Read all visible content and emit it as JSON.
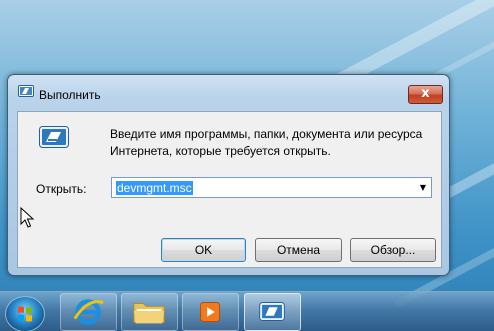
{
  "dialog": {
    "title": "Выполнить",
    "close_glyph": "x",
    "icon": "run-icon",
    "description_line1": "Введите имя программы, папки, документа или ресурса",
    "description_line2": "Интернета, которые требуется открыть.",
    "open_label": "Открыть:",
    "open_value": "devmgmt.msc",
    "ok_label": "OK",
    "cancel_label": "Отмена",
    "browse_label": "Обзор..."
  },
  "taskbar": {
    "items": [
      "start-orb",
      "internet-explorer-icon",
      "windows-explorer-icon",
      "media-player-icon",
      "run-dialog-icon"
    ],
    "active_item": "run-dialog-icon"
  },
  "colors": {
    "selection": "#3399ff",
    "close_button": "#c1401f",
    "wallpaper": "#3f93c7"
  }
}
